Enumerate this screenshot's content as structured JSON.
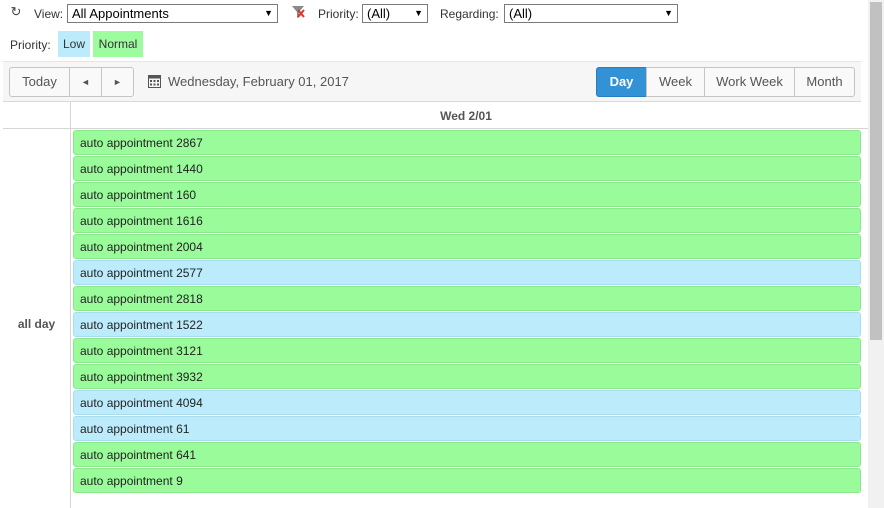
{
  "filters": {
    "view_label": "View:",
    "view_value": "All Appointments",
    "priority_label": "Priority:",
    "priority_value": "(All)",
    "regarding_label": "Regarding:",
    "regarding_value": "(All)"
  },
  "legend": {
    "label": "Priority:",
    "items": [
      {
        "label": "Low",
        "color": "#bcecfb"
      },
      {
        "label": "Normal",
        "color": "#9dfc9d"
      }
    ]
  },
  "toolbar": {
    "today": "Today",
    "prev": "◄",
    "next": "►",
    "date": "Wednesday, February 01, 2017",
    "views": [
      "Day",
      "Week",
      "Work Week",
      "Month"
    ],
    "active_view": "Day"
  },
  "grid": {
    "column_header": "Wed 2/01",
    "allday_label": "all day"
  },
  "events": [
    {
      "title": "auto appointment 2867",
      "priority": "normal"
    },
    {
      "title": "auto appointment 1440",
      "priority": "normal"
    },
    {
      "title": "auto appointment 160",
      "priority": "normal"
    },
    {
      "title": "auto appointment 1616",
      "priority": "normal"
    },
    {
      "title": "auto appointment 2004",
      "priority": "normal"
    },
    {
      "title": "auto appointment 2577",
      "priority": "low"
    },
    {
      "title": "auto appointment 2818",
      "priority": "normal"
    },
    {
      "title": "auto appointment 1522",
      "priority": "low"
    },
    {
      "title": "auto appointment 3121",
      "priority": "normal"
    },
    {
      "title": "auto appointment 3932",
      "priority": "normal"
    },
    {
      "title": "auto appointment 4094",
      "priority": "low"
    },
    {
      "title": "auto appointment 61",
      "priority": "low"
    },
    {
      "title": "auto appointment 641",
      "priority": "normal"
    },
    {
      "title": "auto appointment 9",
      "priority": "normal"
    }
  ],
  "colors": {
    "normal": "#99fb99",
    "low": "#bcecfc",
    "accent": "#3391d6"
  }
}
